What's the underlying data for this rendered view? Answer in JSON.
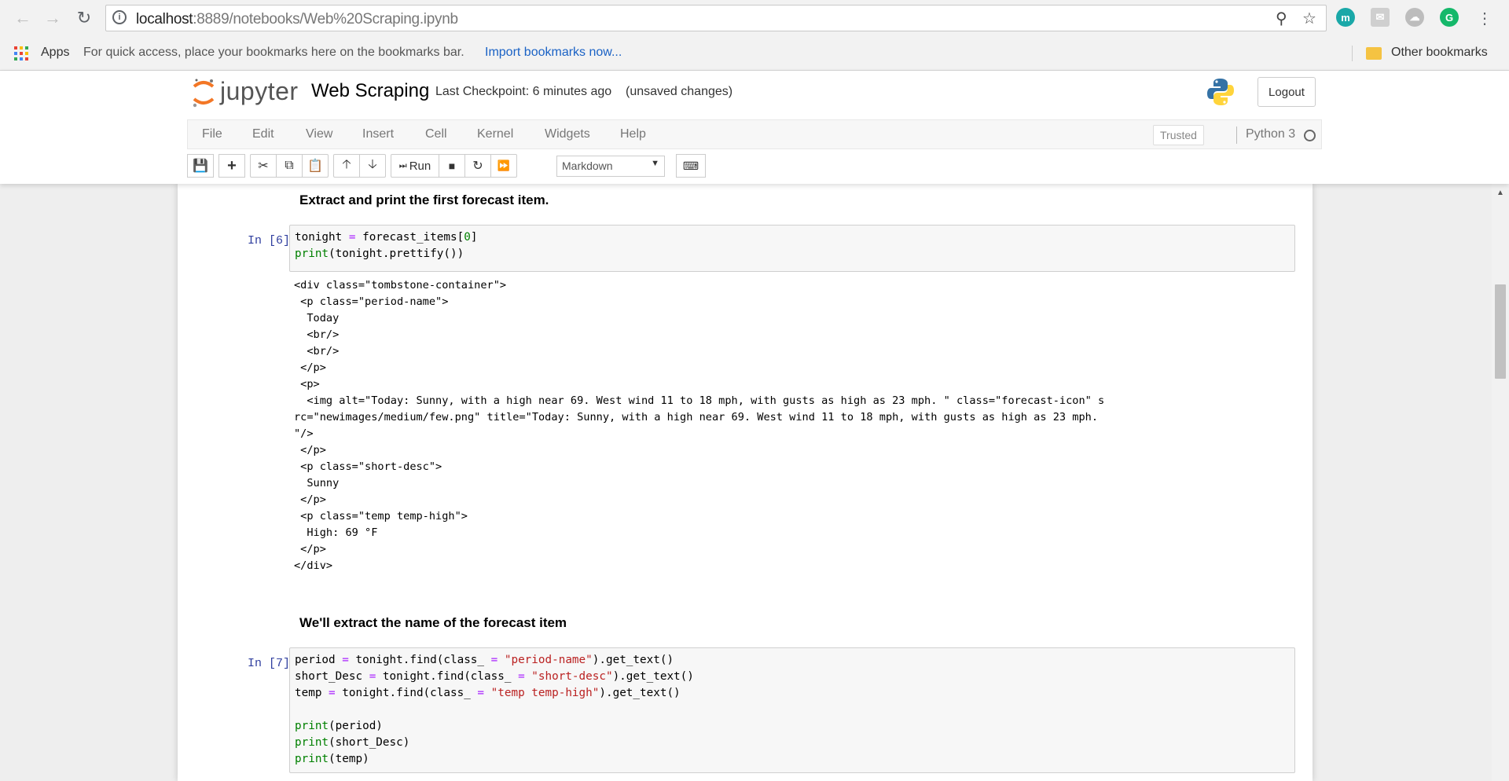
{
  "browser": {
    "url_host": "localhost",
    "url_rest": ":8889/notebooks/Web%20Scraping.ipynb",
    "bookmarks": {
      "apps_label": "Apps",
      "hint": "For quick access, place your bookmarks here on the bookmarks bar.",
      "import_link": "Import bookmarks now...",
      "other": "Other bookmarks"
    }
  },
  "jupyter": {
    "logo_text": "jupyter",
    "title": "Web Scraping",
    "checkpoint": "Last Checkpoint: 6 minutes ago",
    "unsaved": "(unsaved changes)",
    "logout": "Logout",
    "menu": [
      "File",
      "Edit",
      "View",
      "Insert",
      "Cell",
      "Kernel",
      "Widgets",
      "Help"
    ],
    "trusted": "Trusted",
    "kernel": "Python 3",
    "run_label": "Run",
    "cell_type": "Markdown"
  },
  "cells": {
    "md1": "Extract and print the first forecast item.",
    "c6_prompt": "In [6]:",
    "c6_code": [
      "tonight = forecast_items[0]",
      "print(tonight.prettify())"
    ],
    "c6_output": [
      "<div class=\"tombstone-container\">",
      " <p class=\"period-name\">",
      "  Today",
      "  <br/>",
      "  <br/>",
      " </p>",
      " <p>",
      "  <img alt=\"Today: Sunny, with a high near 69. West wind 11 to 18 mph, with gusts as high as 23 mph. \" class=\"forecast-icon\" s",
      "rc=\"newimages/medium/few.png\" title=\"Today: Sunny, with a high near 69. West wind 11 to 18 mph, with gusts as high as 23 mph.",
      "\"/>",
      " </p>",
      " <p class=\"short-desc\">",
      "  Sunny",
      " </p>",
      " <p class=\"temp temp-high\">",
      "  High: 69 °F",
      " </p>",
      "</div>"
    ],
    "md2": "We'll extract the name of the forecast item",
    "c7_prompt": "In [7]:",
    "c7_code": [
      "period = tonight.find(class_ = \"period-name\").get_text()",
      "short_Desc = tonight.find(class_ = \"short-desc\").get_text()",
      "temp = tonight.find(class_ = \"temp temp-high\").get_text()",
      "",
      "print(period)",
      "print(short_Desc)",
      "print(temp)"
    ]
  },
  "colors": {
    "prompt": "#303f9f",
    "keyword": "#008000",
    "string": "#ba2121",
    "operator": "#aa22ff",
    "link": "#1a62c5"
  }
}
